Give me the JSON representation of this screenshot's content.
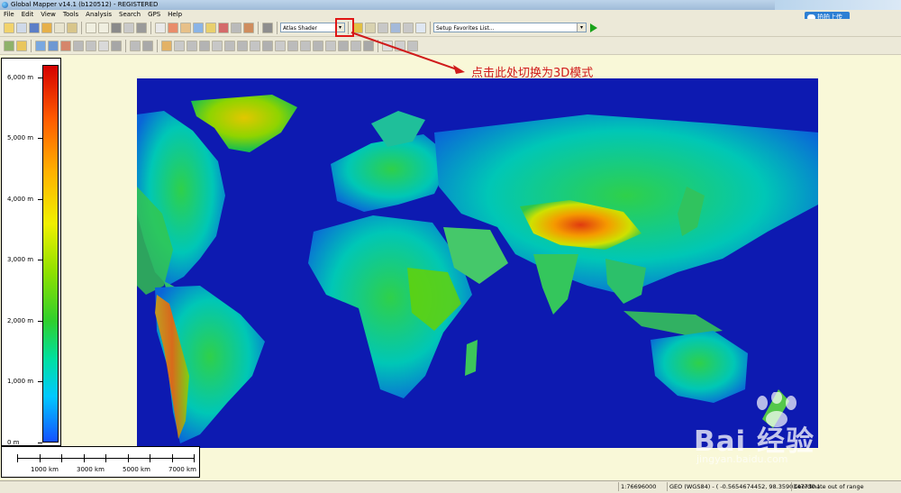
{
  "window": {
    "title": "Global Mapper v14.1 (b120512) - REGISTERED"
  },
  "menu": [
    "File",
    "Edit",
    "View",
    "Tools",
    "Analysis",
    "Search",
    "GPS",
    "Help"
  ],
  "toolbar": {
    "shader_select": "Atlas Shader",
    "favorites_select": "Setup Favorites List..."
  },
  "overlay": {
    "upload_label": "拍拍上传",
    "annotation": "点击此处切换为3D模式",
    "annotation_color": "#d01b1b"
  },
  "legend": {
    "ticks": [
      "6,000 m",
      "5,000 m",
      "4,000 m",
      "3,000 m",
      "2,000 m",
      "1,000 m",
      "0 m"
    ],
    "values": [
      6000,
      5000,
      4000,
      3000,
      2000,
      1000,
      0
    ],
    "min": 0,
    "max": 6200
  },
  "scalebar": {
    "labels": [
      "1000 km",
      "3000 km",
      "5000 km",
      "7000 km"
    ]
  },
  "statusbar": {
    "scale": "1:76696000",
    "coords": "GEO (WGS84) - ( -0.5654674452, 98.3590347730 )",
    "message": "Coordinate out of range"
  },
  "watermark": {
    "brand": "Bai 经验",
    "url": "jingyan.baidu.com"
  },
  "colors": {
    "ocean": "#0d1ab1",
    "viewport_bg": "#f9f8d8",
    "highlight": "#e01616"
  }
}
